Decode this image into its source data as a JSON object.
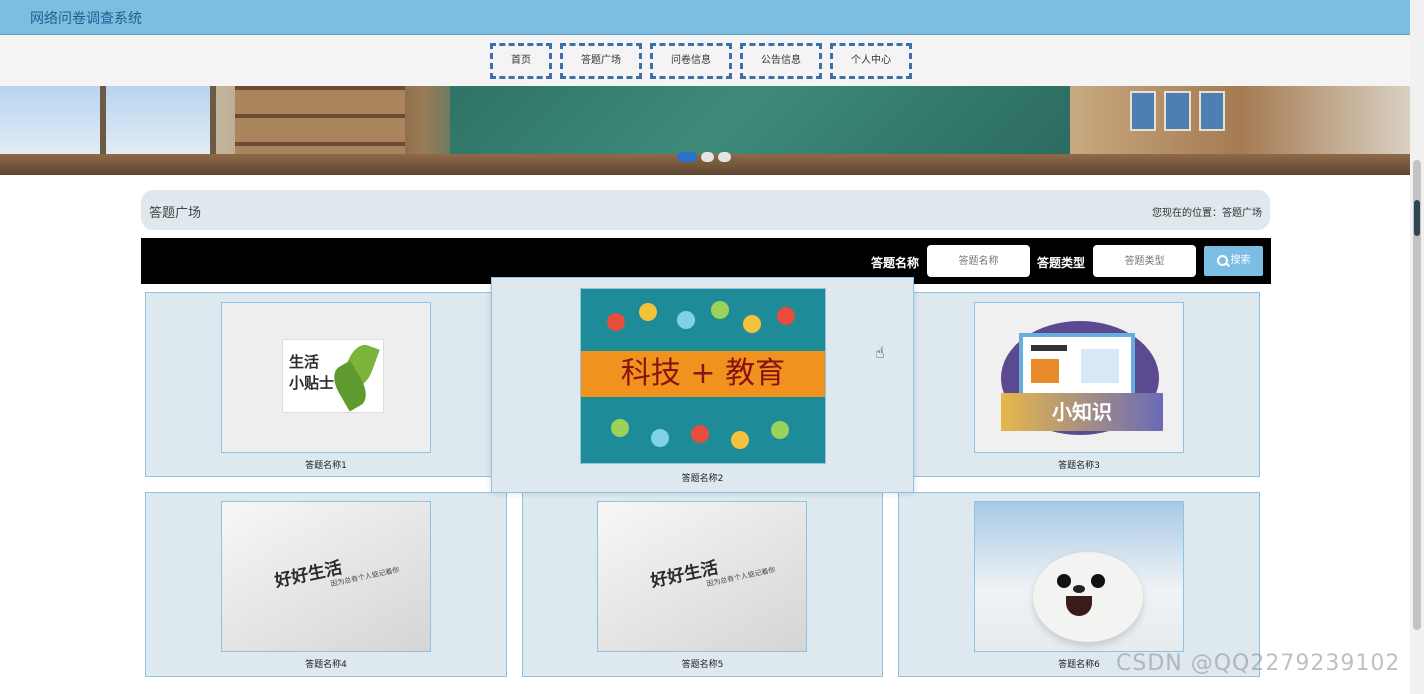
{
  "app": {
    "title": "网络问卷调查系统"
  },
  "nav": {
    "items": [
      "首页",
      "答题广场",
      "问卷信息",
      "公告信息",
      "个人中心"
    ]
  },
  "page": {
    "title": "答题广场",
    "breadcrumb": "您现在的位置：答题广场"
  },
  "search": {
    "name_label": "答题名称",
    "name_placeholder": "答题名称",
    "type_label": "答题类型",
    "type_placeholder": "答题类型",
    "button_label": "搜索"
  },
  "cards": [
    {
      "caption": "答题名称1",
      "image_text": [
        "生活",
        "小贴士"
      ]
    },
    {
      "caption": "答题名称2",
      "image_text": "科技 + 教育"
    },
    {
      "caption": "答题名称3",
      "image_text": "小知识"
    },
    {
      "caption": "答题名称4",
      "image_text": "好好生活",
      "image_subtext": "因为总有个人惦记着你"
    },
    {
      "caption": "答题名称5",
      "image_text": "好好生活",
      "image_subtext": "因为总有个人惦记着你"
    },
    {
      "caption": "答题名称6"
    }
  ],
  "carousel": {
    "slide_count": 3,
    "active_index": 0
  },
  "watermark": "CSDN @QQ2279239102",
  "colors": {
    "header": "#7dbde2",
    "accent": "#2a72c8",
    "card_bg": "#dde9ee",
    "search_button": "#7cbde3"
  }
}
